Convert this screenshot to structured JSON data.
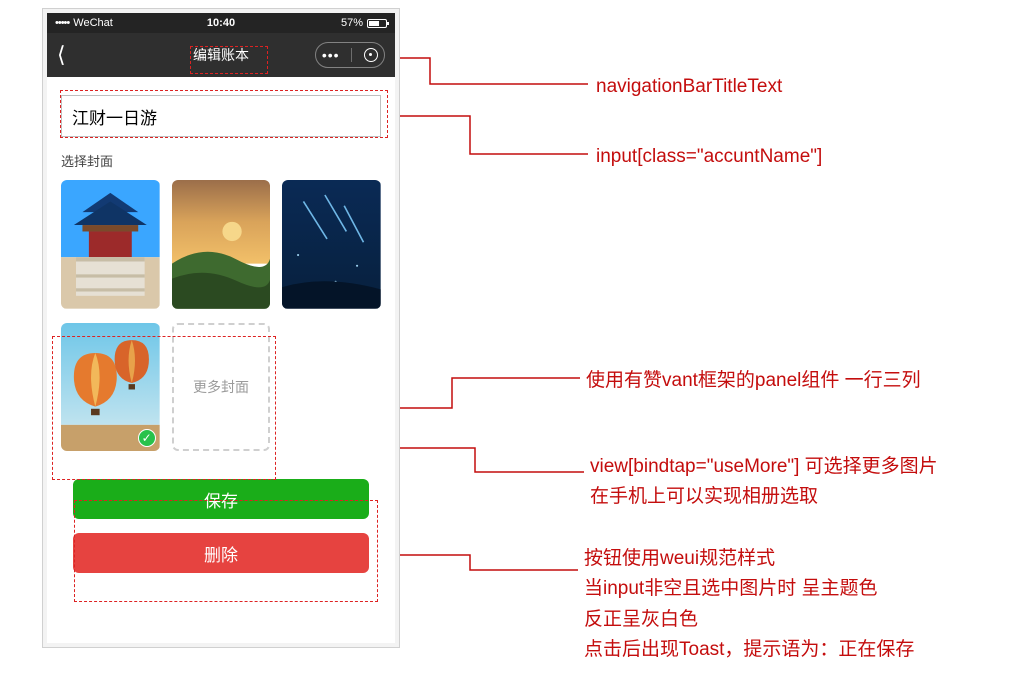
{
  "status": {
    "carrier": "WeChat",
    "time": "10:40",
    "battery_pct": "57%"
  },
  "nav": {
    "title": "编辑账本"
  },
  "form": {
    "account_name_value": "江财一日游",
    "cover_label": "选择封面",
    "more_cover_label": "更多封面"
  },
  "covers": {
    "items": [
      "temple",
      "sunset-fields",
      "night-sky",
      "balloons"
    ],
    "selected_index": 3
  },
  "buttons": {
    "save": "保存",
    "delete": "删除"
  },
  "annotations": {
    "title": "navigationBarTitleText",
    "input": "input[class=\"accuntName\"]",
    "panel": "使用有赞vant框架的panel组件 一行三列",
    "usemore_l1": "view[bindtap=\"useMore\"] 可选择更多图片",
    "usemore_l2": "在手机上可以实现相册选取",
    "btn_l1": "按钮使用weui规范样式",
    "btn_l2": "当input非空且选中图片时 呈主题色",
    "btn_l3": "反正呈灰白色",
    "btn_l4": "点击后出现Toast，提示语为：正在保存"
  }
}
